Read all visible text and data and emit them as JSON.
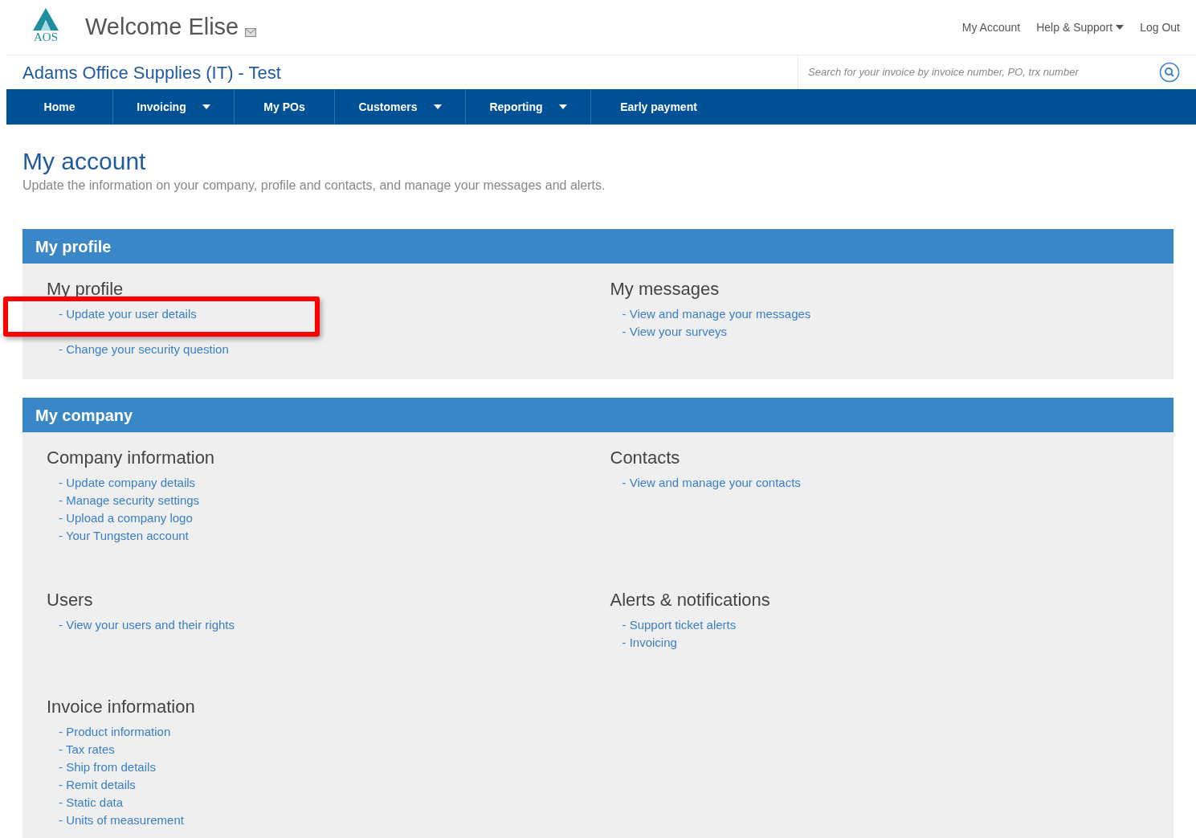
{
  "header": {
    "logo_text": "AOS",
    "welcome": "Welcome Elise",
    "links": [
      {
        "label": "My Account",
        "has_menu": false
      },
      {
        "label": "Help & Support",
        "has_menu": true
      },
      {
        "label": "Log Out",
        "has_menu": false
      }
    ]
  },
  "company_name": "Adams Office Supplies (IT) - Test",
  "search": {
    "placeholder": "Search for your invoice by invoice number, PO, trx number"
  },
  "nav": [
    {
      "label": "Home",
      "has_menu": false
    },
    {
      "label": "Invoicing",
      "has_menu": true
    },
    {
      "label": "My POs",
      "has_menu": false
    },
    {
      "label": "Customers",
      "has_menu": true
    },
    {
      "label": "Reporting",
      "has_menu": true
    },
    {
      "label": "Early payment",
      "has_menu": false
    }
  ],
  "page": {
    "title": "My account",
    "subtitle": "Update the information on your company, profile and contacts, and manage your messages and alerts."
  },
  "panels": [
    {
      "title": "My profile",
      "groups": [
        {
          "heading": "My profile",
          "links": [
            {
              "label": "- Update your user details",
              "highlighted": true
            },
            {
              "label": "- Change your security question",
              "highlighted": false
            }
          ]
        },
        {
          "heading": "My messages",
          "links": [
            {
              "label": "- View and manage your messages",
              "highlighted": false
            },
            {
              "label": "- View your surveys",
              "highlighted": false
            }
          ]
        }
      ]
    },
    {
      "title": "My company",
      "groups": [
        {
          "heading": "Company information",
          "links": [
            {
              "label": "- Update company details",
              "highlighted": false
            },
            {
              "label": "- Manage security settings",
              "highlighted": false
            },
            {
              "label": "- Upload a company logo",
              "highlighted": false
            },
            {
              "label": "- Your Tungsten account",
              "highlighted": false
            }
          ]
        },
        {
          "heading": "Contacts",
          "links": [
            {
              "label": "- View and manage your contacts",
              "highlighted": false
            }
          ]
        },
        {
          "heading": "Users",
          "links": [
            {
              "label": "- View your users and their rights",
              "highlighted": false
            }
          ]
        },
        {
          "heading": "Alerts & notifications",
          "links": [
            {
              "label": "- Support ticket alerts",
              "highlighted": false
            },
            {
              "label": "- Invoicing",
              "highlighted": false
            }
          ]
        },
        {
          "heading": "Invoice information",
          "links": [
            {
              "label": "- Product information",
              "highlighted": false
            },
            {
              "label": "- Tax rates",
              "highlighted": false
            },
            {
              "label": "- Ship from details",
              "highlighted": false
            },
            {
              "label": "- Remit details",
              "highlighted": false
            },
            {
              "label": "- Static data",
              "highlighted": false
            },
            {
              "label": "- Units of measurement",
              "highlighted": false
            }
          ]
        }
      ]
    }
  ]
}
